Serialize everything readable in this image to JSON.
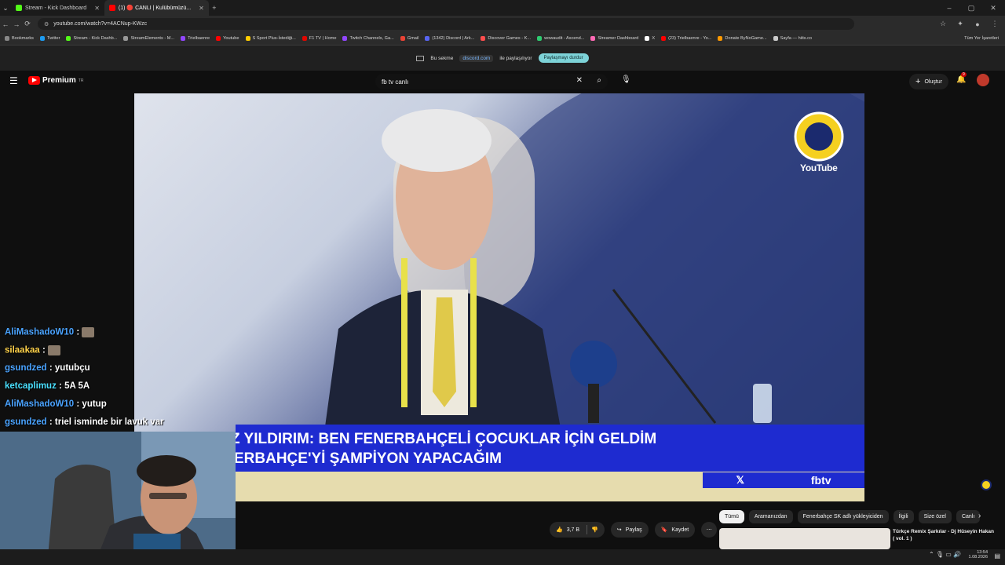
{
  "browser": {
    "tabs": [
      {
        "title": "Stream - Kick Dashboard",
        "active": false
      },
      {
        "title": "(1) 🔴 CANLI | Kulübümüzü...",
        "active": true
      }
    ],
    "url": "youtube.com/watch?v=4ACNup-KWzc",
    "bookmarks": [
      "Bookmarks",
      "Twitter",
      "Stream - Kick Dashb...",
      "StreamElements - M...",
      "Trielbaenre",
      "Youtube",
      "S Sport Plus-İstediği...",
      "F1 TV | Home",
      "Twitch Channels, Ga...",
      "Gmail",
      "(1342) Discord | Ark...",
      "Discover Games - K...",
      "wowaudit - Ascend...",
      "Streamer Dashboard",
      "X",
      "(23) Trielbaenre - Yo...",
      "Donate ByNoGame...",
      "Sayfa — hiits.co"
    ],
    "all_bookmarks": "Tüm Yer İşaretleri"
  },
  "sharebar": {
    "prefix": "Bu sekme",
    "domain": "discord.com",
    "suffix": "ile paylaşılıyor",
    "stop_label": "Paylaşmayı durdur"
  },
  "youtube": {
    "logo": "Premium",
    "region": "TR",
    "search_query": "fb tv canlı",
    "create_label": "Oluştur",
    "notifications_count": "9",
    "watermark": "YouTube",
    "headline_1": "Z YILDIRIM: BEN FENERBAHÇELİ ÇOCUKLAR İÇİN GELDİM",
    "headline_2": "ERBAHÇE'Yİ ŞAMPİYON YAPACAĞIM",
    "channel_tag": "fbtv",
    "likes": "3,7 B",
    "share_label": "Paylaş",
    "save_label": "Kaydet",
    "chips": [
      "Tümü",
      "Aramanızdan",
      "Fenerbahçe SK adlı yükleyiciden",
      "İlgili",
      "Size özel",
      "Canlı"
    ],
    "suggested_title": "Türkçe Remix Şarkılar - Dj Hüseyin Hakan ( vol. 1 )"
  },
  "chat": [
    {
      "user": "AliMashadoW10",
      "msg": "",
      "color": "#4aa3ff"
    },
    {
      "user": "silaakaa",
      "msg": "",
      "color": "#ffd24a"
    },
    {
      "user": "gsundzed",
      "msg": "yutubçu",
      "color": "#4aa3ff"
    },
    {
      "user": "ketcaplimuz",
      "msg": "5A 5A",
      "color": "#4ae0ff"
    },
    {
      "user": "AliMashadoW10",
      "msg": "yutup",
      "color": "#4aa3ff"
    },
    {
      "user": "gsundzed",
      "msg": "triel isminde bir lavuk var",
      "color": "#4aa3ff"
    }
  ],
  "taskbar": {
    "time": "13:54",
    "date": "1.08.2026"
  }
}
